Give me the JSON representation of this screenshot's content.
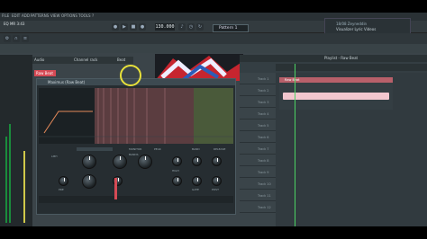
{
  "menu": [
    "FILE",
    "EDIT",
    "ADD",
    "PATTERNS",
    "VIEW",
    "OPTIONS",
    "TOOLS",
    "?"
  ],
  "toolbar": {
    "hint": "EQ MR 3:43",
    "tempo": "130.000",
    "pattern": "Pattern 1"
  },
  "news": {
    "line1": "18/08 Zeyneddin",
    "line2": "Visualizer Lyric Videos"
  },
  "channel_rack": {
    "audio_label": "Audio",
    "title": "Channel rack",
    "beat_label": "Beat",
    "channel_name": "Raw Beat"
  },
  "plugin": {
    "title": "Maximus (Raw Beat)",
    "labels": [
      "LMH",
      "PEAK",
      "BAND",
      "RELEASE",
      "MONITOR",
      "BANDS",
      "HIGH",
      "PRE",
      "POST",
      "GATE"
    ]
  },
  "playlist": {
    "title": "Playlist - Raw Beat",
    "clip_name": "Raw Beat",
    "tracks": [
      "Track 1",
      "Track 2",
      "Track 3",
      "Track 4",
      "Track 5",
      "Track 6",
      "Track 7",
      "Track 8",
      "Track 9",
      "Track 10",
      "Track 11",
      "Track 12"
    ]
  },
  "colors": {
    "accent_red": "#d64a55",
    "clip": "#b8606a",
    "playhead": "#4cd364",
    "highlight": "#e8e13a"
  }
}
